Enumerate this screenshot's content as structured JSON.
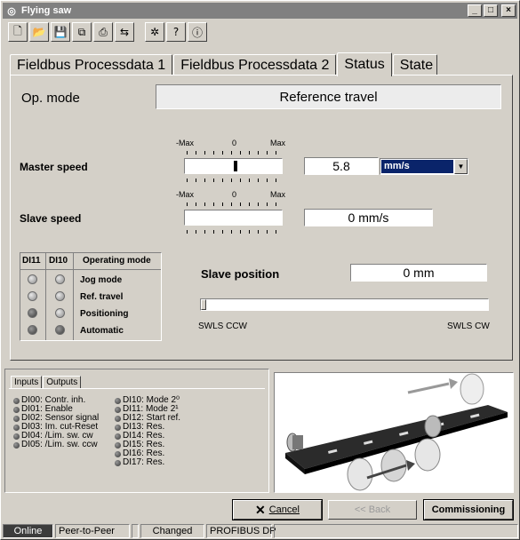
{
  "window": {
    "title": "Flying saw",
    "icons": [
      "app-icon",
      "minimize-icon",
      "maximize-icon",
      "close-icon"
    ]
  },
  "toolbar": {
    "buttons": [
      {
        "icon": "new-file-icon",
        "glyph": "🗋"
      },
      {
        "icon": "open-folder-icon",
        "glyph": "📂"
      },
      {
        "icon": "save-icon",
        "glyph": "💾"
      },
      {
        "icon": "copy-icon",
        "glyph": "⧉"
      },
      {
        "icon": "print-icon",
        "glyph": "⎙"
      },
      {
        "icon": "compare-icon",
        "glyph": "⇆"
      },
      {
        "icon": "tools-icon",
        "glyph": "✲"
      },
      {
        "icon": "help-icon",
        "glyph": "?"
      },
      {
        "icon": "info-icon",
        "glyph": "ⓘ"
      }
    ]
  },
  "tabs": [
    "Fieldbus Processdata 1",
    "Fieldbus Processdata 2",
    "Status",
    "State"
  ],
  "active_tab": "Status",
  "status": {
    "op_mode_label": "Op. mode",
    "op_mode_value": "Reference travel",
    "master_speed_label": "Master speed",
    "master_speed_value": "5.8",
    "master_speed_unit": "mm/s",
    "slave_speed_label": "Slave speed",
    "slave_speed_value": "0 mm/s",
    "scale_min": "-Max",
    "scale_mid": "0",
    "scale_max": "Max",
    "slave_position_label": "Slave position",
    "slave_position_value": "0 mm",
    "slider_left_label": "SWLS CCW",
    "slider_right_label": "SWLS CW",
    "di_headers": [
      "DI11",
      "DI10",
      "Operating mode"
    ],
    "modes": [
      "Jog mode",
      "Ref. travel",
      "Positioning",
      "Automatic"
    ],
    "di11_states": [
      false,
      false,
      true,
      true
    ],
    "di10_states": [
      false,
      false,
      false,
      true
    ]
  },
  "io": {
    "tabs": [
      "Inputs",
      "Outputs"
    ],
    "inputs_col1": [
      "DI00: Contr. inh.",
      "DI01: Enable",
      "DI02: Sensor signal",
      "DI03: Im. cut-Reset",
      "DI04: /Lim. sw. cw",
      "DI05: /Lim. sw. ccw"
    ],
    "inputs_col2": [
      "DI10: Mode 2⁰",
      "DI11: Mode 2¹",
      "DI12: Start ref.",
      "DI13: Res.",
      "DI14: Res.",
      "DI15: Res.",
      "DI16: Res.",
      "DI17: Res."
    ]
  },
  "buttons": {
    "cancel": "Cancel",
    "back": "<< Back",
    "commissioning": "Commissioning"
  },
  "statusbar": [
    "Online",
    "Peer-to-Peer",
    "",
    "Changed",
    "PROFIBUS DP"
  ],
  "colors": {
    "title_bar": "#808080",
    "selection": "#0a246a",
    "face": "#d4d0c8"
  }
}
